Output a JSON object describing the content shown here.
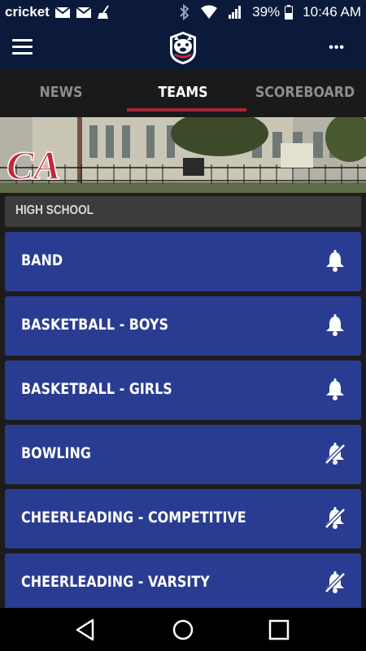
{
  "status": {
    "carrier": "cricket",
    "battery_pct": "39%",
    "time": "10:46 AM"
  },
  "header": {
    "menu_icon": "hamburger-menu-icon",
    "logo_icon": "bulldog-logo",
    "more_icon": "more-options-icon"
  },
  "tabs": [
    {
      "label": "NEWS",
      "active": false
    },
    {
      "label": "TEAMS",
      "active": true
    },
    {
      "label": "SCOREBOARD",
      "active": false
    }
  ],
  "banner": {
    "logo_text": "CA"
  },
  "section": {
    "title": "HIGH SCHOOL"
  },
  "teams": [
    {
      "label": "BAND",
      "notifications": "bell-icon"
    },
    {
      "label": "BASKETBALL - BOYS",
      "notifications": "bell-icon"
    },
    {
      "label": "BASKETBALL - GIRLS",
      "notifications": "bell-icon"
    },
    {
      "label": "BOWLING",
      "notifications": "bell-off-icon"
    },
    {
      "label": "CHEERLEADING - COMPETITIVE",
      "notifications": "bell-off-icon"
    },
    {
      "label": "CHEERLEADING - VARSITY",
      "notifications": "bell-off-icon"
    }
  ],
  "colors": {
    "header_bg": "#0b1a3a",
    "item_bg": "#2a3c92",
    "tab_indicator": "#a6273a"
  }
}
